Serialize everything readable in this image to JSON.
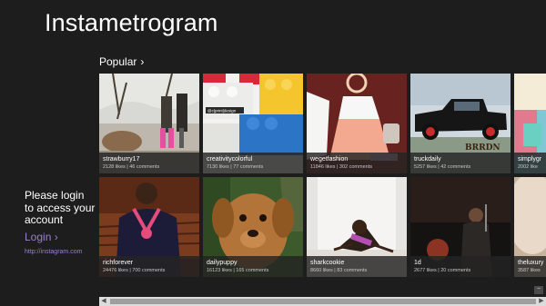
{
  "app": {
    "title": "Instametrogram"
  },
  "login": {
    "prompt": "Please login to access your account",
    "link_label": "Login",
    "link_chevron": "›",
    "url": "http://instagram.com"
  },
  "section": {
    "title": "Popular",
    "chevron": "›"
  },
  "tiles": [
    {
      "user": "strawburry17",
      "stats": "2128 likes | 46 comments"
    },
    {
      "user": "creativitycolorful",
      "stats": "7130 likes | 77 comments"
    },
    {
      "user": "wegetfashion",
      "stats": "11846 likes | 302 comments"
    },
    {
      "user": "truckdaily",
      "stats": "5257 likes | 42 comments"
    },
    {
      "user": "simplygr",
      "stats": "2002 like"
    },
    {
      "user": "richforever",
      "stats": "24476 likes | 700 comments"
    },
    {
      "user": "dailypuppy",
      "stats": "16123 likes | 165 comments"
    },
    {
      "user": "sharkcookie",
      "stats": "8660 likes | 83 comments"
    },
    {
      "user": "1d",
      "stats": "2677 likes | 20 comments"
    },
    {
      "user": "theluxury",
      "stats": "3587 likes"
    }
  ],
  "photo_texts": {
    "lego_tag": "@c|print|design",
    "truck_watermark": "BRRDN"
  },
  "scrollbar": {
    "left_arrow": "◀",
    "right_arrow": "▶"
  },
  "window": {
    "minimize": "−"
  },
  "colors": {
    "background": "#1d1d1d",
    "accent": "#9a7fd1",
    "caption_bg": "#232323"
  }
}
